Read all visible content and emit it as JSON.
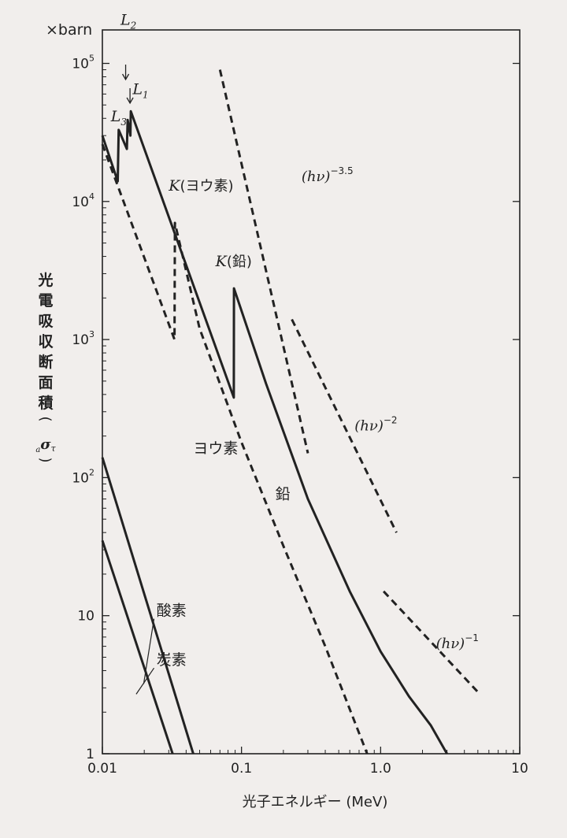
{
  "chart_data": {
    "type": "line",
    "title": "",
    "xlabel": "光子エネルギー (MeV)",
    "ylabel_chars": [
      "光",
      "電",
      "吸",
      "収",
      "断",
      "面",
      "積",
      "(",
      "aστ",
      ")"
    ],
    "y_unit": "×barn",
    "x_scale": "log",
    "y_scale": "log",
    "xlim": [
      0.01,
      10
    ],
    "ylim": [
      1,
      300000
    ],
    "x_tick_labels": [
      {
        "value": 0.01,
        "label": "0.01"
      },
      {
        "value": 0.1,
        "label": "0.1"
      },
      {
        "value": 1.0,
        "label": "1.0"
      },
      {
        "value": 10,
        "label": "10"
      }
    ],
    "y_ticks": [
      {
        "value": 1,
        "base": "1",
        "exp": ""
      },
      {
        "value": 10,
        "base": "10",
        "exp": ""
      },
      {
        "value": 100,
        "base": "10",
        "exp": "2"
      },
      {
        "value": 1000,
        "base": "10",
        "exp": "3"
      },
      {
        "value": 10000,
        "base": "10",
        "exp": "4"
      },
      {
        "value": 100000,
        "base": "10",
        "exp": "5"
      }
    ],
    "grid": false,
    "series": [
      {
        "name": "鉛",
        "style": "solid",
        "x": [
          0.01,
          0.0129,
          0.0131,
          0.015,
          0.0152,
          0.0159,
          0.016,
          0.088,
          0.088,
          0.0883,
          0.15,
          0.3,
          0.6,
          1.0,
          1.6,
          2.3,
          3.0
        ],
        "y": [
          30000,
          14000,
          33000,
          24000,
          39000,
          30000,
          45000,
          380,
          380,
          2350,
          480,
          70,
          15,
          5.5,
          2.6,
          1.6,
          1.0
        ]
      },
      {
        "name": "ヨウ素",
        "style": "dashed",
        "x": [
          0.01,
          0.033,
          0.0332,
          0.05,
          0.1,
          0.2,
          0.4,
          0.8
        ],
        "y": [
          26000,
          1000,
          7000,
          1200,
          180,
          32,
          6,
          1.0
        ]
      },
      {
        "name": "酸素",
        "style": "solid",
        "x": [
          0.01,
          0.045
        ],
        "y": [
          140,
          1
        ]
      },
      {
        "name": "炭素",
        "style": "solid",
        "x": [
          0.01,
          0.032
        ],
        "y": [
          35,
          1
        ]
      },
      {
        "name": "(hν)^-3.5",
        "style": "dashed",
        "x": [
          0.07,
          0.3
        ],
        "y": [
          90000,
          150
        ]
      },
      {
        "name": "(hν)^-2",
        "style": "dashed",
        "x": [
          0.23,
          1.3
        ],
        "y": [
          1400,
          40
        ]
      },
      {
        "name": "(hν)^-1",
        "style": "dashed",
        "x": [
          1.05,
          5.0
        ],
        "y": [
          15,
          2.8
        ]
      }
    ],
    "annotations": [
      {
        "id": "L1",
        "letter": "L",
        "sub": "1",
        "x": 0.0165,
        "y": 60000
      },
      {
        "id": "L2",
        "letter": "L",
        "sub": "2",
        "x": 0.0135,
        "y": 190000
      },
      {
        "id": "L3",
        "letter": "L",
        "sub": "3",
        "x": 0.0115,
        "y": 38000
      },
      {
        "id": "K-iodine",
        "letter": "K",
        "text": "(ヨウ素)",
        "x": 0.03,
        "y": 12000
      },
      {
        "id": "K-lead",
        "letter": "K",
        "text": "(鉛)",
        "x": 0.065,
        "y": 3400
      },
      {
        "id": "iodine-label",
        "text": "ヨウ素",
        "x": 0.045,
        "y": 150
      },
      {
        "id": "lead-label",
        "text": "鉛",
        "x": 0.175,
        "y": 70
      },
      {
        "id": "oxygen-label",
        "text": "酸素",
        "x": 0.0245,
        "y": 10
      },
      {
        "id": "carbon-label",
        "text": "炭素",
        "x": 0.0245,
        "y": 4.4
      },
      {
        "id": "slope-3.5",
        "base": "(hν)",
        "exp": "−3.5",
        "x": 0.27,
        "y": 14000
      },
      {
        "id": "slope-2",
        "base": "(hν)",
        "exp": "−2",
        "x": 0.65,
        "y": 220
      },
      {
        "id": "slope-1",
        "base": "(hν)",
        "exp": "−1",
        "x": 2.5,
        "y": 5.8
      }
    ]
  }
}
